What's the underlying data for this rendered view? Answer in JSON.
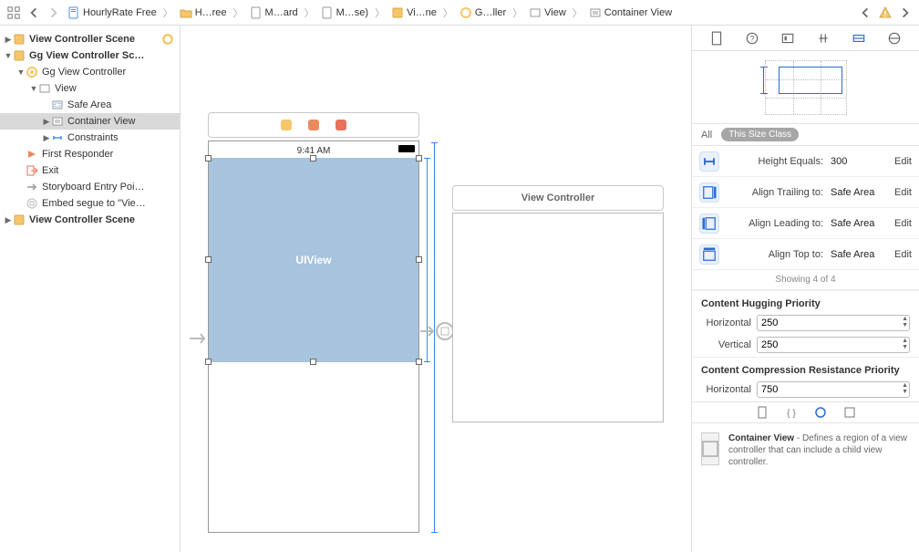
{
  "breadcrumb": {
    "items": [
      {
        "icon": "doc-blue",
        "label": "HourlyRate Free"
      },
      {
        "icon": "folder",
        "label": "H…ree"
      },
      {
        "icon": "doc",
        "label": "M…ard"
      },
      {
        "icon": "doc",
        "label": "M…se)"
      },
      {
        "icon": "scene",
        "label": "Vi…ne"
      },
      {
        "icon": "vc",
        "label": "G…ller"
      },
      {
        "icon": "view",
        "label": "View"
      },
      {
        "icon": "container",
        "label": "Container View"
      }
    ]
  },
  "outline": {
    "rows": [
      {
        "indent": 0,
        "disc": "▶",
        "icon": "scene",
        "label": "View Controller Scene",
        "bold": true,
        "extra": "dot"
      },
      {
        "indent": 0,
        "disc": "▼",
        "icon": "scene",
        "label": "Gg View Controller Sc…",
        "bold": true
      },
      {
        "indent": 1,
        "disc": "▼",
        "icon": "vc",
        "label": "Gg View Controller"
      },
      {
        "indent": 2,
        "disc": "▼",
        "icon": "view",
        "label": "View"
      },
      {
        "indent": 3,
        "disc": "",
        "icon": "safearea",
        "label": "Safe Area"
      },
      {
        "indent": 3,
        "disc": "▶",
        "icon": "container",
        "label": "Container View",
        "selected": true
      },
      {
        "indent": 3,
        "disc": "▶",
        "icon": "constraints",
        "label": "Constraints"
      },
      {
        "indent": 1,
        "disc": "",
        "icon": "responder",
        "label": "First Responder"
      },
      {
        "indent": 1,
        "disc": "",
        "icon": "exit",
        "label": "Exit"
      },
      {
        "indent": 1,
        "disc": "",
        "icon": "arrow",
        "label": "Storyboard Entry Poi…"
      },
      {
        "indent": 1,
        "disc": "",
        "icon": "segue",
        "label": "Embed segue to \"Vie…"
      },
      {
        "indent": 0,
        "disc": "▶",
        "icon": "scene",
        "label": "View Controller Scene",
        "bold": true
      }
    ]
  },
  "canvas": {
    "status_time": "9:41 AM",
    "container_label": "UIView",
    "embedded_title": "View Controller"
  },
  "inspector": {
    "sizeclass": {
      "all": "All",
      "pill": "This Size Class"
    },
    "constraints": [
      {
        "label": "Height Equals:",
        "value": "300",
        "edit": "Edit"
      },
      {
        "label": "Align Trailing to:",
        "value": "Safe Area",
        "edit": "Edit"
      },
      {
        "label": "Align Leading to:",
        "value": "Safe Area",
        "edit": "Edit"
      },
      {
        "label": "Align Top to:",
        "value": "Safe Area",
        "edit": "Edit"
      }
    ],
    "showing": "Showing 4 of 4",
    "hugging_title": "Content Hugging Priority",
    "hugging_h_label": "Horizontal",
    "hugging_h": "250",
    "hugging_v_label": "Vertical",
    "hugging_v": "250",
    "compression_title": "Content Compression Resistance Priority",
    "compression_h_label": "Horizontal",
    "compression_h": "750",
    "desc_title": "Container View",
    "desc_body": " - Defines a region of a view controller that can include a child view controller."
  }
}
